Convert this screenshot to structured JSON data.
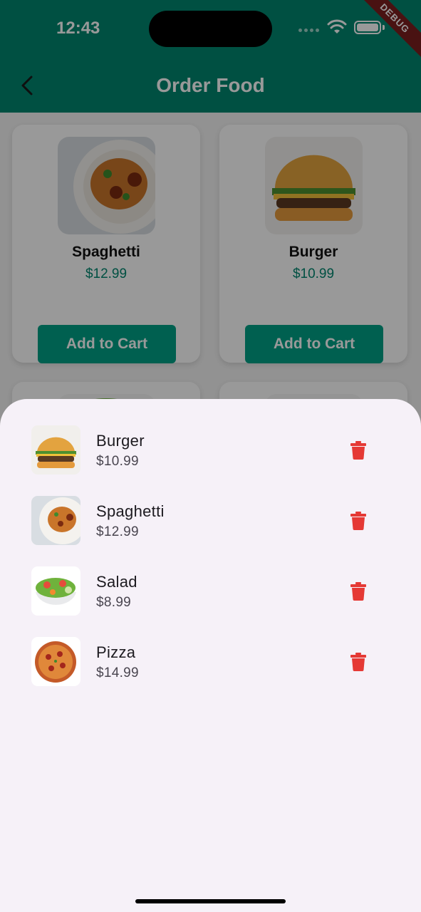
{
  "status": {
    "time": "12:43",
    "debug_label": "DEBUG"
  },
  "app": {
    "title": "Order Food"
  },
  "colors": {
    "primary": "#00866f",
    "button": "#00a085",
    "delete": "#e53935",
    "sheet_bg": "#f6f1f8"
  },
  "menu": [
    {
      "name": "Spaghetti",
      "price": "$12.99",
      "button": "Add to Cart",
      "icon": "spaghetti-image"
    },
    {
      "name": "Burger",
      "price": "$10.99",
      "button": "Add to Cart",
      "icon": "burger-image"
    }
  ],
  "cart": [
    {
      "name": "Burger",
      "price": "$10.99",
      "icon": "burger-image"
    },
    {
      "name": "Spaghetti",
      "price": "$12.99",
      "icon": "spaghetti-image"
    },
    {
      "name": "Salad",
      "price": "$8.99",
      "icon": "salad-image"
    },
    {
      "name": "Pizza",
      "price": "$14.99",
      "icon": "pizza-image"
    }
  ]
}
